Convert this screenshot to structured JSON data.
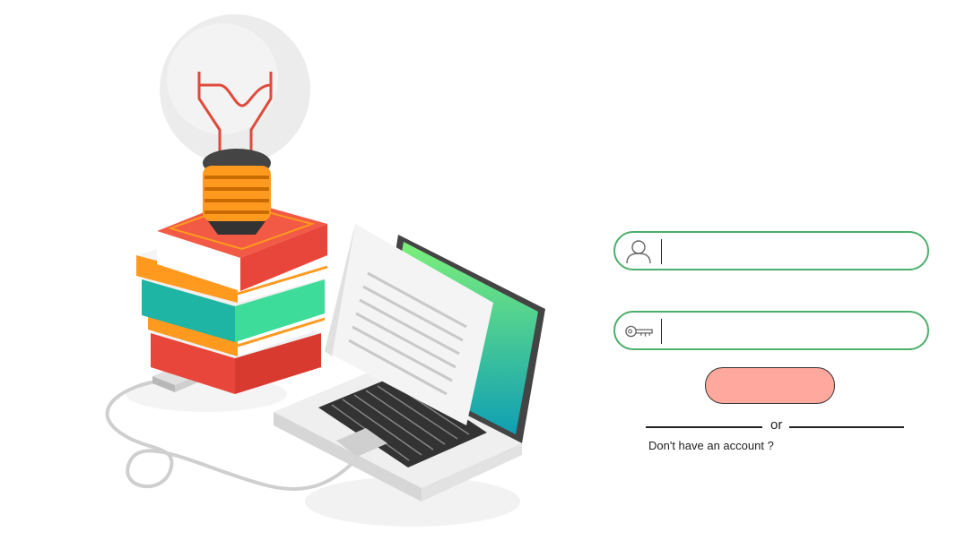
{
  "login_form": {
    "username": {
      "value": "",
      "placeholder": "",
      "icon": "user-icon"
    },
    "password": {
      "value": "",
      "placeholder": "",
      "icon": "key-icon"
    },
    "submit_label": "",
    "divider_text": "or",
    "signup_prompt": "Don't have an account ?"
  },
  "theme": {
    "field_border": "#4caf6a",
    "button_fill": "#ffa89e"
  }
}
